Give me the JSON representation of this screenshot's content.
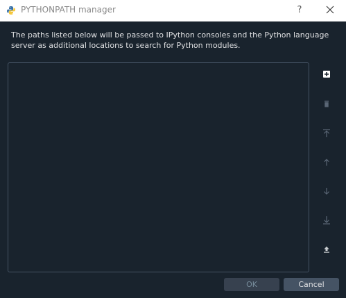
{
  "window": {
    "title": "PYTHONPATH manager",
    "help_label": "?",
    "icon": "python-logo-icon",
    "close_icon": "close-icon"
  },
  "description": "The paths listed below will be passed to IPython consoles and the Python language server as additional locations to search for Python modules.",
  "path_list": {
    "items": []
  },
  "toolbar": [
    {
      "name": "add-path-button",
      "icon": "plus-square-icon"
    },
    {
      "name": "remove-path-button",
      "icon": "trash-icon"
    },
    {
      "name": "move-to-top-button",
      "icon": "arrow-to-top-icon"
    },
    {
      "name": "move-up-button",
      "icon": "arrow-up-icon"
    },
    {
      "name": "move-down-button",
      "icon": "arrow-down-icon"
    },
    {
      "name": "move-to-bottom-button",
      "icon": "arrow-to-bottom-icon"
    },
    {
      "name": "export-button",
      "icon": "export-icon"
    }
  ],
  "buttons": {
    "ok_label": "OK",
    "cancel_label": "Cancel"
  },
  "colors": {
    "background": "#19232d",
    "border": "#455364",
    "text": "#e0e1e3",
    "icon": "#c9cdd0",
    "icon_disabled": "#5a6675"
  }
}
